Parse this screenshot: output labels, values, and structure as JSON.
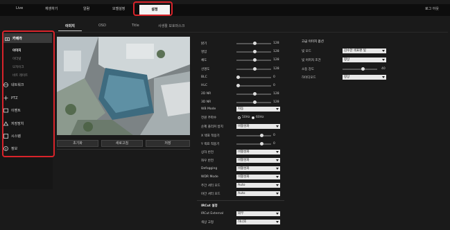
{
  "nav": {
    "items": [
      "Live",
      "재생하기",
      "알람",
      "모델설정",
      "설정"
    ],
    "logout": "로그 아웃"
  },
  "tabs": [
    "이미지",
    "OSD",
    "Title",
    "사생활 보호마스크"
  ],
  "sidebar": {
    "camera": "카메라",
    "sub": [
      "이미지",
      "이더넷",
      "모자이크",
      "비트 레이트"
    ],
    "items": [
      "네트워크",
      "PTZ",
      "이벤트",
      "저장장치",
      "시스템",
      "정보"
    ]
  },
  "preview_buttons": [
    "초기화",
    "새로고침",
    "저장"
  ],
  "settings": {
    "sliders": [
      {
        "label": "밝기",
        "value": "128",
        "level": 0.5
      },
      {
        "label": "명암",
        "value": "128",
        "level": 0.5
      },
      {
        "label": "채도",
        "value": "128",
        "level": 0.5
      },
      {
        "label": "선명도",
        "value": "128",
        "level": 0.5
      },
      {
        "label": "BLC",
        "value": "0",
        "level": 0
      },
      {
        "label": "HLC",
        "value": "0",
        "level": 0
      },
      {
        "label": "2D NR",
        "value": "128",
        "level": 0.5
      },
      {
        "label": "3D NR",
        "value": "128",
        "level": 0.5
      }
    ],
    "wb_mode": {
      "label": "WB Mode",
      "value": "자동"
    },
    "power_freq": {
      "label": "전원 주파수",
      "opt1": "50Hz",
      "opt2": "60Hz"
    },
    "auto_shutter": {
      "label": "순제 플리커 방지",
      "value": "비활성화"
    },
    "x_ref": {
      "label": "X 색표 적용기",
      "value": "0"
    },
    "y_ref": {
      "label": "Y 색표 적용기",
      "value": "0"
    },
    "selects": [
      {
        "label": "상하 반전",
        "value": "비활성화"
      },
      {
        "label": "좌우 반전",
        "value": "비활성화"
      },
      {
        "label": "Defogging",
        "value": "비활성화"
      },
      {
        "label": "WDR Mode",
        "value": "비활성화"
      },
      {
        "label": "주간 셔터 모드",
        "value": "Auto"
      },
      {
        "label": "야간 셔터 모드",
        "value": "Auto"
      }
    ],
    "ircut": {
      "title": "IRCut 설정",
      "external_label": "IRCut External",
      "external_value": "외부",
      "color_label": "색상 고정",
      "color_value": "하나호"
    }
  },
  "advanced": {
    "title": "고급 이미지 옵션",
    "rows": [
      {
        "label": "빛 모드",
        "value": "감수한 색표편 빛"
      },
      {
        "label": "빛 어퍼처 조건",
        "value": "향상"
      },
      {
        "label": "소등 강도",
        "value": "40",
        "level": 0.6
      },
      {
        "label": "하이디모드",
        "value": "향상"
      }
    ]
  },
  "colors": {
    "highlight": "#d9232a"
  }
}
